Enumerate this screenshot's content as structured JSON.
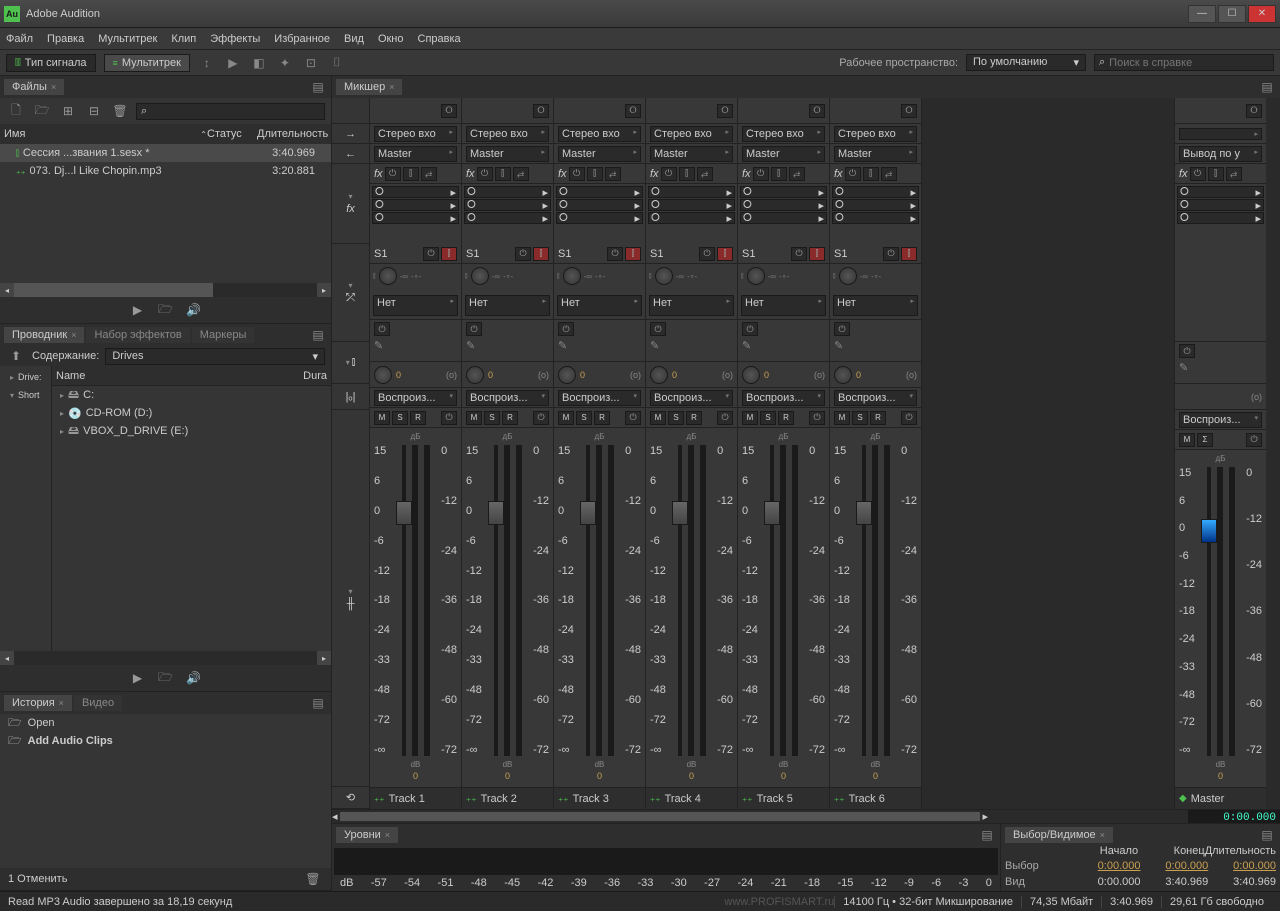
{
  "app": {
    "title": "Adobe Audition",
    "icon": "Au"
  },
  "menu": [
    "Файл",
    "Правка",
    "Мультитрек",
    "Клип",
    "Эффекты",
    "Избранное",
    "Вид",
    "Окно",
    "Справка"
  ],
  "modes": {
    "signal": "Тип сигнала",
    "multitrack": "Мультитрек"
  },
  "workspace": {
    "label": "Рабочее пространство:",
    "value": "По умолчанию"
  },
  "search": {
    "placeholder": "Поиск в справке"
  },
  "files": {
    "tab": "Файлы",
    "cols": {
      "name": "Имя",
      "status": "Статус",
      "duration": "Длительность"
    },
    "rows": [
      {
        "icon": "sesx",
        "name": "Сессия ...звания 1.sesx *",
        "dur": "3:40.969"
      },
      {
        "icon": "wav",
        "name": "073. Dj...l Like Chopin.mp3",
        "dur": "3:20.881"
      }
    ]
  },
  "explorer": {
    "tabs": [
      "Проводник",
      "Набор эффектов",
      "Маркеры"
    ],
    "contentLabel": "Содержание:",
    "drivesLabel": "Drives",
    "side": [
      "Drive:",
      "Short"
    ],
    "cols": {
      "name": "Name",
      "dur": "Dura"
    },
    "drives": [
      "C:",
      "CD-ROM (D:)",
      "VBOX_D_DRIVE (E:)"
    ]
  },
  "history": {
    "tabs": [
      "История",
      "Видео"
    ],
    "items": [
      "Open",
      "Add Audio Clips"
    ],
    "undo": "1 Отменить"
  },
  "mixer": {
    "tab": "Микшер",
    "stereoIn": "Стерео вхо",
    "master": "Master",
    "send": "S1",
    "sendNone": "Нет",
    "playback": "Воспроиз...",
    "msr": [
      "M",
      "S",
      "R"
    ],
    "scale": [
      "15",
      "6",
      "0",
      "-6",
      "-12",
      "-18",
      "-24",
      "-33",
      "-48",
      "-72",
      "-∞"
    ],
    "meterScale": [
      "0",
      "-12",
      "-24",
      "-36",
      "-48",
      "-60",
      "-72"
    ],
    "db": "дБ",
    "dbUnit": "dB",
    "pan": "0",
    "neginf": "-∞",
    "tracks": [
      "Track 1",
      "Track 2",
      "Track 3",
      "Track 4",
      "Track 5",
      "Track 6"
    ],
    "masterTrack": "Master",
    "masterOut": "Вывод по у",
    "msrMaster": [
      "M",
      "Σ"
    ],
    "timecode": "0:00.000"
  },
  "levels": {
    "tab": "Уровни",
    "scale": [
      "dB",
      "-57",
      "-54",
      "-51",
      "-48",
      "-45",
      "-42",
      "-39",
      "-36",
      "-33",
      "-30",
      "-27",
      "-24",
      "-21",
      "-18",
      "-15",
      "-12",
      "-9",
      "-6",
      "-3",
      "0"
    ]
  },
  "selection": {
    "tab": "Выбор/Видимое",
    "cols": [
      "Начало",
      "Конец",
      "Длительность"
    ],
    "sel": "Выбор",
    "view": "Вид",
    "selvals": [
      "0:00.000",
      "0:00.000",
      "0:00.000"
    ],
    "viewvals": [
      "0:00.000",
      "3:40.969",
      "3:40.969"
    ]
  },
  "status": {
    "msg": "Read MP3 Audio завершено за 18,19 секунд",
    "watermark": "www.PROFISMART.ru",
    "sample": "14100 Гц • 32-бит Микширование",
    "size": "74,35 Мбайт",
    "dur": "3:40.969",
    "free": "29,61 Гб свободно"
  }
}
